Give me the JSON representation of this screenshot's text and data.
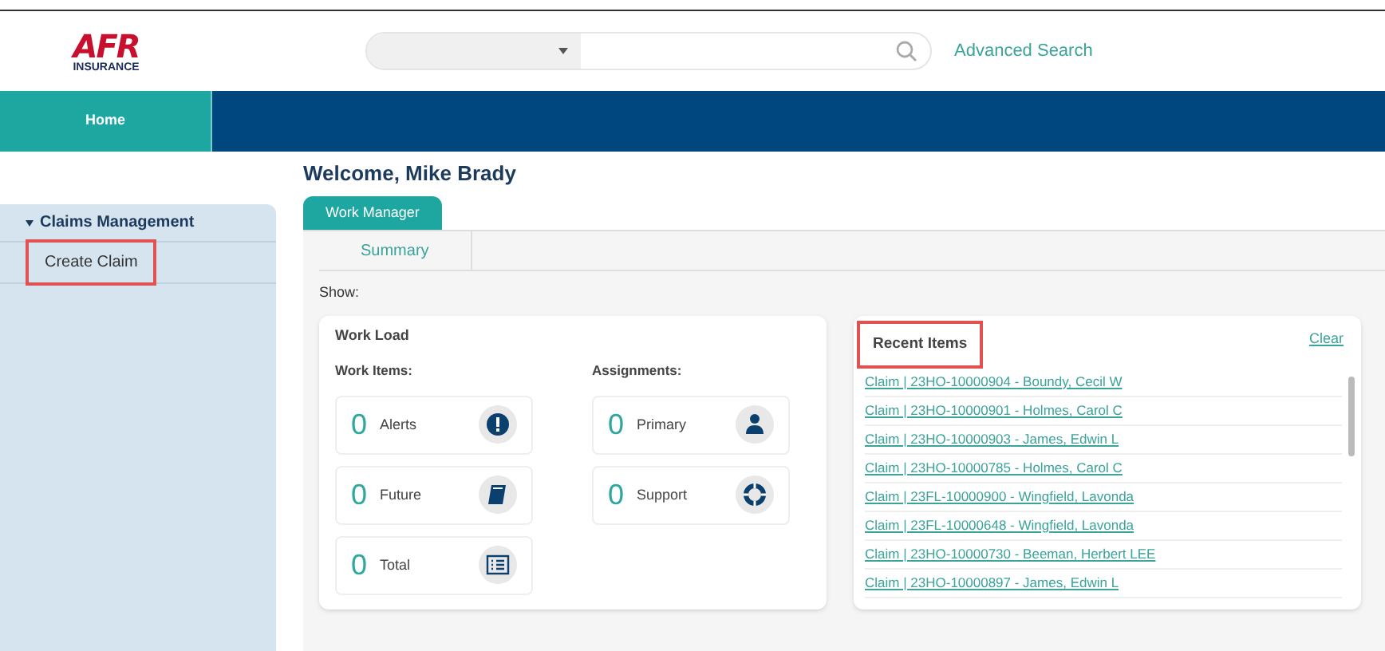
{
  "logo": {
    "main": "AFR",
    "sub": "INSURANCE"
  },
  "search": {
    "advanced_link": "Advanced Search"
  },
  "nav": [
    {
      "label": "Home",
      "selected": true
    }
  ],
  "sidebar": {
    "section": {
      "label": "Claims Management",
      "expanded": true,
      "items": [
        {
          "label": "Create Claim",
          "highlighted": true
        }
      ]
    }
  },
  "welcome": "Welcome, Mike Brady",
  "tabs": [
    {
      "label": "Work Manager",
      "selected": true
    }
  ],
  "subtabs": [
    {
      "label": "Summary",
      "selected": true
    }
  ],
  "show_label": "Show:",
  "workload": {
    "title": "Work Load",
    "groups": [
      {
        "title": "Work Items:",
        "items": [
          {
            "count": "0",
            "label": "Alerts",
            "kind": "alert"
          },
          {
            "count": "0",
            "label": "Future",
            "kind": "book"
          },
          {
            "count": "0",
            "label": "Total",
            "kind": "list"
          }
        ]
      },
      {
        "title": "Assignments:",
        "items": [
          {
            "count": "0",
            "label": "Primary",
            "kind": "person"
          },
          {
            "count": "0",
            "label": "Support",
            "kind": "lifebuoy"
          }
        ]
      }
    ]
  },
  "recent": {
    "title": "Recent Items",
    "highlighted": true,
    "clear": "Clear",
    "items": [
      "Claim | 23HO-10000904 - Boundy, Cecil W",
      "Claim | 23HO-10000901 - Holmes, Carol C",
      "Claim | 23HO-10000903 - James, Edwin L",
      "Claim | 23HO-10000785 - Holmes, Carol C",
      "Claim | 23FL-10000900 - Wingfield, Lavonda",
      "Claim | 23FL-10000648 - Wingfield, Lavonda",
      "Claim | 23HO-10000730 - Beeman, Herbert LEE",
      "Claim | 23HO-10000897 - James, Edwin L"
    ]
  }
}
